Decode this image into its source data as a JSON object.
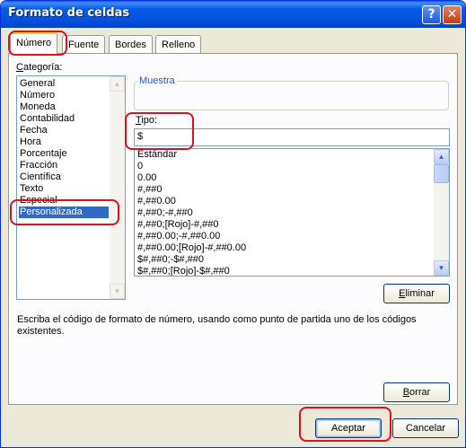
{
  "window": {
    "title": "Formato de celdas",
    "help_label": "?",
    "close_label": "✕"
  },
  "tabs": [
    {
      "label": "Número"
    },
    {
      "label": "Fuente"
    },
    {
      "label": "Bordes"
    },
    {
      "label": "Relleno"
    }
  ],
  "categoria": {
    "label_prefix": "C",
    "label_rest": "ategoría:",
    "items": [
      "General",
      "Número",
      "Moneda",
      "Contabilidad",
      "Fecha",
      "Hora",
      "Porcentaje",
      "Fracción",
      "Científica",
      "Texto",
      "Especial",
      "Personalizada"
    ],
    "selected": "Personalizada"
  },
  "muestra": {
    "legend": "Muestra",
    "value": ""
  },
  "tipo": {
    "label_prefix": "T",
    "label_rest": "ipo:",
    "value": "$",
    "formats": [
      "Estándar",
      "0",
      "0.00",
      "#,##0",
      "#,##0.00",
      "#,##0;-#,##0",
      "#,##0;[Rojo]-#,##0",
      "#,##0.00;-#,##0.00",
      "#,##0.00;[Rojo]-#,##0.00",
      "$#,##0;-$#,##0",
      "$#,##0;[Rojo]-$#,##0"
    ]
  },
  "buttons": {
    "eliminar_prefix": "E",
    "eliminar_rest": "liminar",
    "borrar_prefix": "B",
    "borrar_rest": "orrar",
    "aceptar": "Aceptar",
    "cancelar": "Cancelar"
  },
  "description": "Escriba el código de formato de número, usando como punto de partida uno de los códigos existentes.",
  "scroll_arrows": {
    "up": "▲",
    "down": "▼"
  },
  "icons": {
    "help": "help-icon",
    "close": "close-icon",
    "scroll-up": "arrow-up-icon",
    "scroll-down": "arrow-down-icon"
  },
  "colors": {
    "titlebar": "#0453dd",
    "selection": "#316ac5",
    "annotation": "#e01020",
    "dialog": "#ece9d8"
  }
}
